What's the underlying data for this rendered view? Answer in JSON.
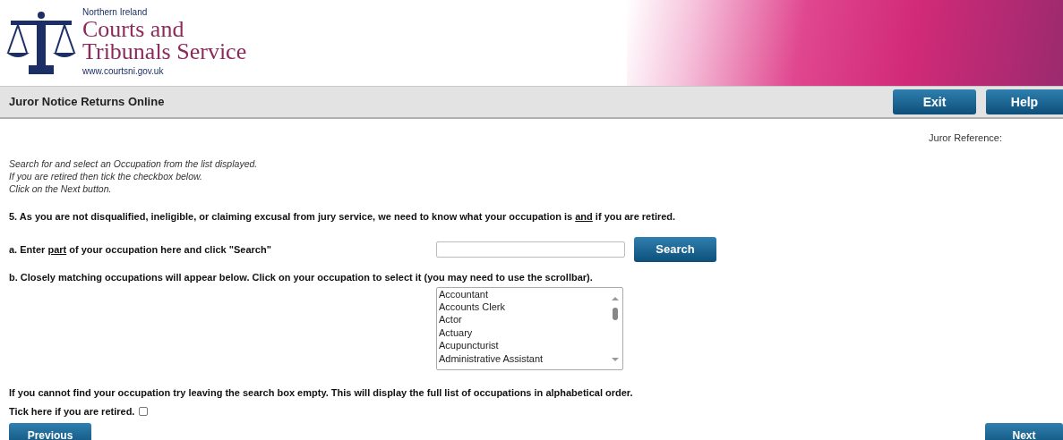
{
  "header": {
    "logo_region": "Northern Ireland",
    "logo_title_line_1": "Courts and",
    "logo_title_line_2": "Tribunals Service",
    "logo_url": "www.courtsni.gov.uk"
  },
  "title_bar": {
    "title": "Juror Notice Returns Online",
    "buttons": [
      "Exit",
      "Help"
    ]
  },
  "juror_reference": "Juror Reference:",
  "instructions": [
    "Search for and select an Occupation from the list displayed.",
    "If you are retired then tick the checkbox below.",
    "Click on the Next button."
  ],
  "question": [
    {
      "text": "5. As you are not disqualified, ineligible, or claiming excusal from jury service, we need to know what your occupation is ",
      "underline": false
    },
    {
      "text": "and",
      "underline": true
    },
    {
      "text": " if you are retired.",
      "underline": false
    }
  ],
  "search_label": [
    {
      "text": "a. Enter ",
      "underline": false
    },
    {
      "text": "part",
      "underline": true
    },
    {
      "text": " of your occupation here and click \"Search\"",
      "underline": false
    }
  ],
  "search_button": "Search",
  "list_label": "b. Closely matching occupations will appear below. Click on your occupation to select it (you may need to use the scrollbar).",
  "occupations": [
    {
      "label": "Accountant",
      "selected": false
    },
    {
      "label": "Accounts Clerk",
      "selected": false
    },
    {
      "label": "Actor",
      "selected": false
    },
    {
      "label": "Actuary",
      "selected": false
    },
    {
      "label": "Acupuncturist",
      "selected": false
    },
    {
      "label": "Administrative Assistant",
      "selected": false
    }
  ],
  "hint": "If you cannot find your occupation try leaving the search box empty. This will display the full list of occupations in alphabetical order.",
  "retired": {
    "label": "Tick here if you are retired.",
    "checked": false
  },
  "nav": {
    "previous": "Previous",
    "next": "Next"
  }
}
